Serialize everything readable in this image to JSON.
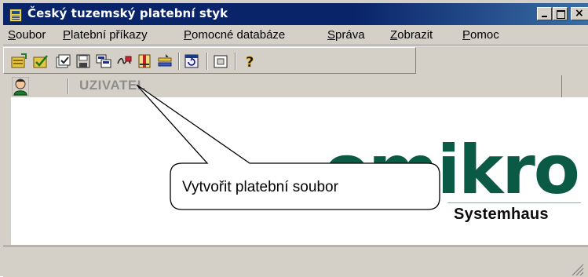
{
  "window": {
    "title": "Český tuzemský platební styk",
    "controls": {
      "minimize": "_",
      "maximize": "□",
      "close": "×"
    }
  },
  "menu": {
    "items": [
      {
        "first": "S",
        "rest": "oubor"
      },
      {
        "first": "P",
        "rest": "latební příkazy"
      },
      {
        "first": "P",
        "rest": "omocné databáze"
      },
      {
        "first": "S",
        "rest": "práva"
      },
      {
        "first": "Z",
        "rest": "obrazit"
      },
      {
        "first": "P",
        "rest": "omoc"
      }
    ]
  },
  "toolbar": {
    "icons": [
      "import-payments-icon",
      "edit-payments-icon",
      "check-payments-icon",
      "save-payment-file-icon",
      "copy-icon",
      "signature-icon",
      "book-icon",
      "transfer-icon",
      "refresh-icon",
      "window-icon",
      "help-icon"
    ]
  },
  "user": {
    "label": "UZIVATEL",
    "avatar_icon": "user-avatar-icon"
  },
  "logo": {
    "word": "omikron",
    "subtitle": "Systemhaus",
    "color": "#0a5a46"
  },
  "callout": {
    "text": "Vytvořit platební soubor"
  }
}
